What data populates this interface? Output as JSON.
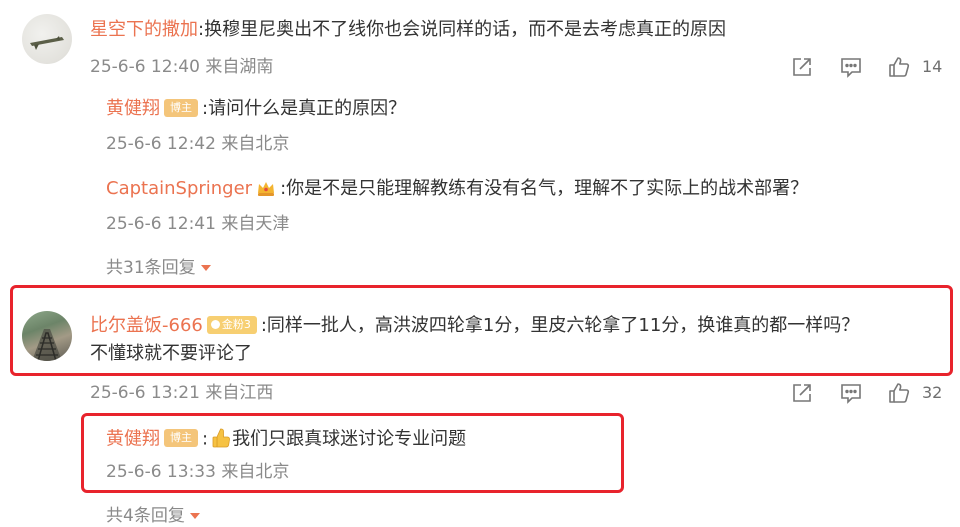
{
  "comments": [
    {
      "username": "星空下的撒加",
      "text": ":换穆里尼奥出不了线你也会说同样的话，而不是去考虑真正的原因",
      "time": "25-6-6 12:40 来自湖南",
      "likes": "14",
      "replies": [
        {
          "username": "黄健翔",
          "badge": "博主",
          "text": ":请问什么是真正的原因？",
          "time": "25-6-6 12:42 来自北京"
        },
        {
          "username": "CaptainSpringer",
          "badge_icon": "crown-icon",
          "text": ":你是不是只能理解教练有没有名气，理解不了实际上的战术部署？",
          "time": "25-6-6 12:41 来自天津"
        }
      ],
      "more_replies": "共31条回复"
    },
    {
      "username": "比尔盖饭-666",
      "badge": "金粉3",
      "text_line1": ":同样一批人，高洪波四轮拿1分，里皮六轮拿了11分，换谁真的都一样吗？",
      "text_line2": "不懂球就不要评论了",
      "time": "25-6-6 13:21 来自江西",
      "likes": "32",
      "replies": [
        {
          "username": "黄健翔",
          "badge": "博主",
          "emoji": "thumbs-up-emoji",
          "text": "我们只跟真球迷讨论专业问题",
          "time": "25-6-6 13:33 来自北京"
        }
      ],
      "more_replies": "共4条回复"
    }
  ],
  "icons": {
    "share": "share-icon",
    "comment": "comment-icon",
    "like": "like-icon"
  },
  "colors": {
    "username": "#eb7350",
    "highlight": "#e8232c",
    "meta": "#8a8a8a"
  }
}
